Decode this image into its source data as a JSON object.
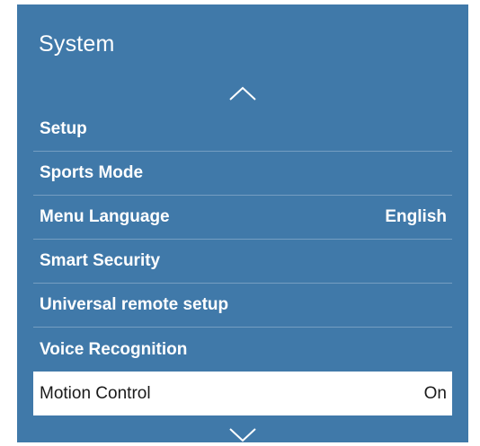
{
  "panel": {
    "title": "System",
    "background_color": "#4079a9",
    "scroll_up_icon": "chevron-up-icon",
    "scroll_down_icon": "chevron-down-icon"
  },
  "menu": {
    "items": [
      {
        "label": "Setup",
        "value": ""
      },
      {
        "label": "Sports Mode",
        "value": ""
      },
      {
        "label": "Menu Language",
        "value": "English"
      },
      {
        "label": "Smart Security",
        "value": ""
      },
      {
        "label": "Universal remote setup",
        "value": ""
      },
      {
        "label": "Voice Recognition",
        "value": ""
      },
      {
        "label": "Motion Control",
        "value": "On",
        "selected": true
      }
    ]
  }
}
